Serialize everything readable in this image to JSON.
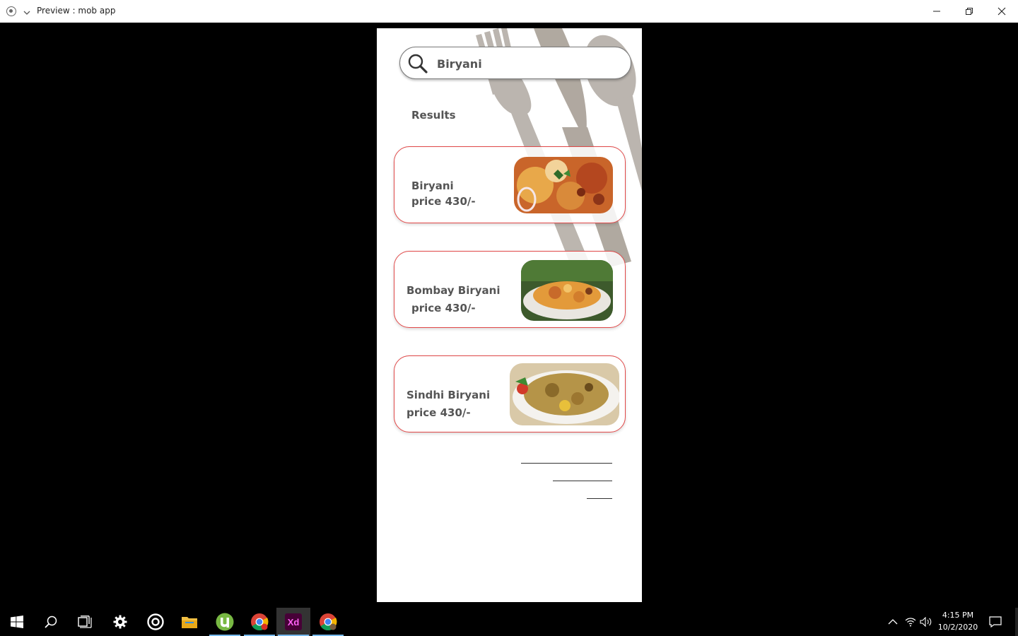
{
  "window": {
    "title": "Preview : mob app"
  },
  "app": {
    "search": {
      "value": "Biryani",
      "placeholder": "Search"
    },
    "results_label": "Results",
    "items": [
      {
        "name": "Biryani",
        "price": "price 430/-"
      },
      {
        "name": "Bombay Biryani",
        "price": "price 430/-"
      },
      {
        "name": "Sindhi Biryani",
        "price": "price 430/-"
      }
    ]
  },
  "taskbar": {
    "apps": [
      "start-icon",
      "search-icon",
      "task-view-icon",
      "settings-icon",
      "groove-icon",
      "file-explorer-icon",
      "utorrent-icon",
      "chrome-icon",
      "adobe-xd-icon",
      "chrome-icon"
    ],
    "xd_label": "Xd",
    "time": "4:15 PM",
    "date": "10/2/2020"
  },
  "colors": {
    "card_border": "#e04848",
    "text": "#555555",
    "taskbar_active": "#76b9ed",
    "xd_bg": "#470137",
    "xd_fg": "#ff61f6"
  }
}
